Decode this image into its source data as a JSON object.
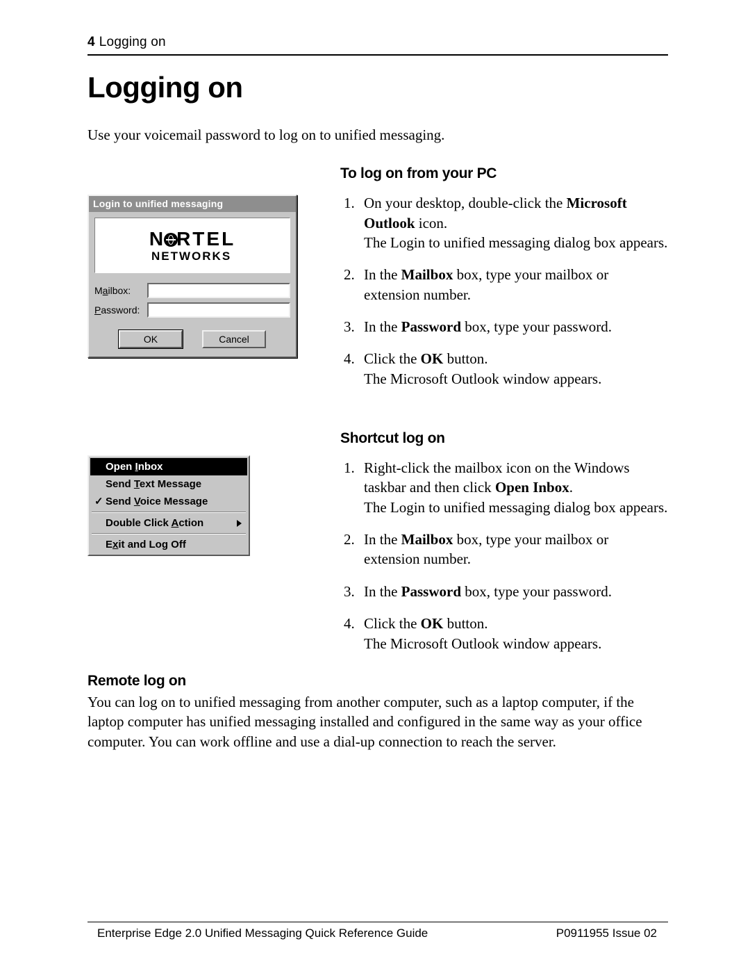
{
  "header": {
    "page_num": "4",
    "running": "Logging on"
  },
  "title": "Logging on",
  "intro": "Use your voicemail password to log on to unified messaging.",
  "dialog": {
    "title": "Login to unified messaging",
    "brand_top_left": "N",
    "brand_top_right": "RTEL",
    "brand_bottom": "NETWORKS",
    "mailbox_label_pre": "M",
    "mailbox_label_ul": "a",
    "mailbox_label_post": "ilbox:",
    "password_label_ul": "P",
    "password_label_post": "assword:",
    "ok": "OK",
    "cancel": "Cancel"
  },
  "pc": {
    "heading": "To log on from your PC",
    "s1a": "On your desktop, double-click the ",
    "s1b": "Microsoft Outlook",
    "s1c": " icon.",
    "s1d": "The Login to unified messaging dialog box appears.",
    "s2a": "In the ",
    "s2b": "Mailbox",
    "s2c": " box, type your mailbox or extension number.",
    "s3a": "In the ",
    "s3b": "Password",
    "s3c": " box, type your password.",
    "s4a": "Click the ",
    "s4b": "OK",
    "s4c": " button.",
    "s4d": "The Microsoft Outlook window appears."
  },
  "menu": {
    "i1_pre": "Open ",
    "i1_ul": "I",
    "i1_post": "nbox",
    "i2_pre": "Send ",
    "i2_ul": "T",
    "i2_post": "ext Message",
    "i3_pre": "Send ",
    "i3_ul": "V",
    "i3_post": "oice Message",
    "i4_pre": "Double Click ",
    "i4_ul": "A",
    "i4_post": "ction",
    "i5_pre": "E",
    "i5_ul": "x",
    "i5_post": "it and Log Off"
  },
  "shortcut": {
    "heading": "Shortcut log on",
    "s1a": "Right-click the mailbox icon on the Windows taskbar and then click ",
    "s1b": "Open Inbox",
    "s1c": ".",
    "s1d": "The Login to unified messaging dialog box appears.",
    "s2a": "In the ",
    "s2b": "Mailbox",
    "s2c": " box, type your mailbox or extension number.",
    "s3a": "In the ",
    "s3b": "Password",
    "s3c": " box, type your password.",
    "s4a": "Click the ",
    "s4b": "OK",
    "s4c": " button.",
    "s4d": "The Microsoft Outlook window appears."
  },
  "remote": {
    "heading": "Remote log on",
    "body": "You can log on to unified messaging from another computer, such as a laptop computer, if the laptop computer has unified messaging installed and configured in the same way as your office computer. You can work offline and use a dial-up connection to reach the server."
  },
  "footer": {
    "left": "Enterprise Edge 2.0 Unified Messaging Quick Reference Guide",
    "right": "P0911955 Issue 02"
  }
}
